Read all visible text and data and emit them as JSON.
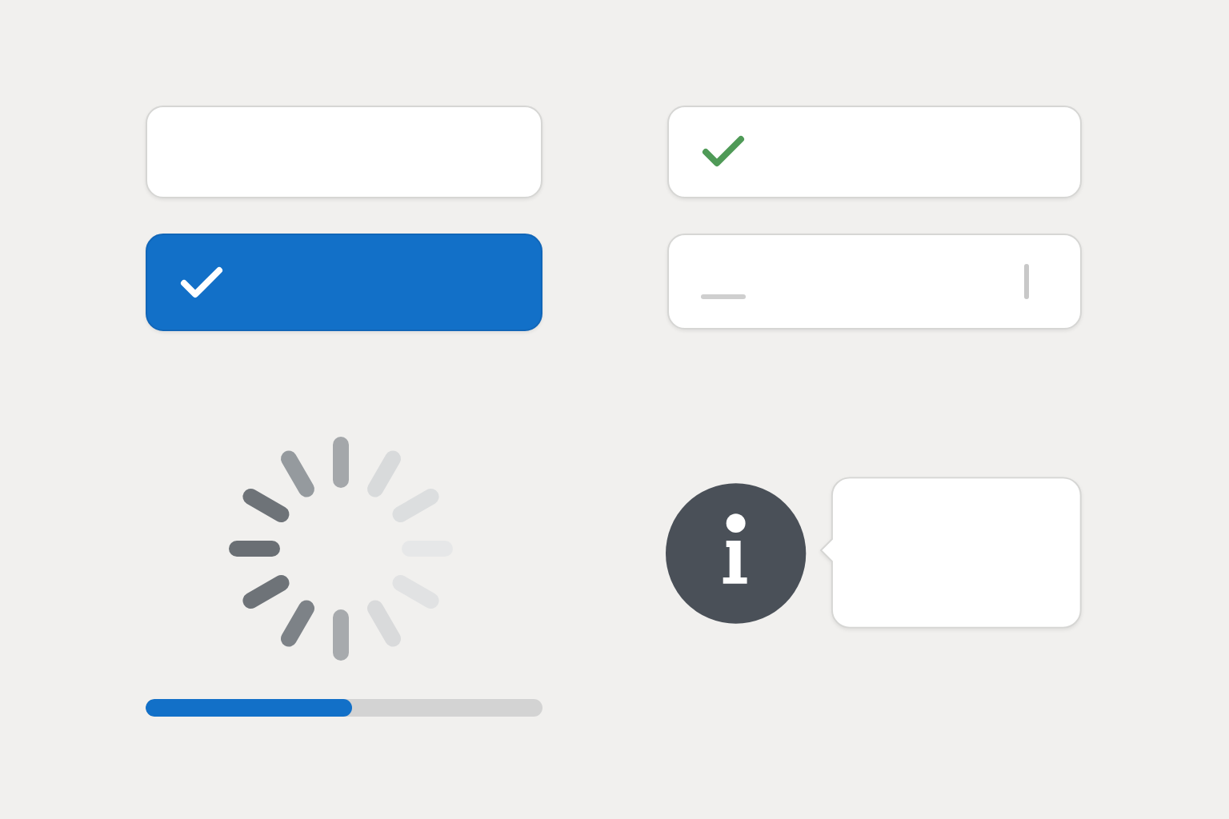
{
  "choices": [
    {
      "selected": false
    },
    {
      "selected": true
    }
  ],
  "fields": [
    {
      "kind": "validated"
    },
    {
      "kind": "focused"
    }
  ],
  "progress": {
    "level": 0.52
  },
  "tooltip": {
    "kind": "info"
  }
}
